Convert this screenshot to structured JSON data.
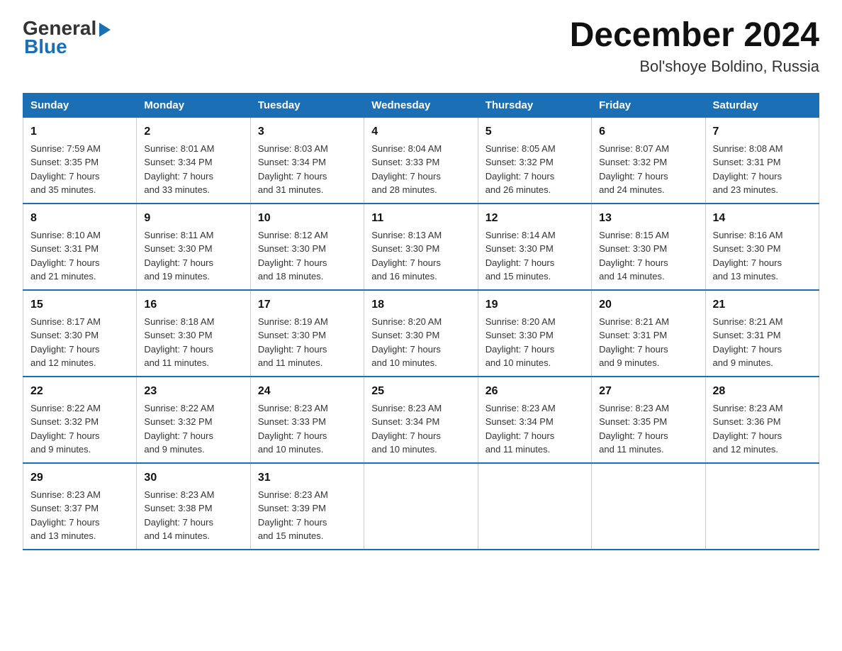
{
  "logo": {
    "text_general": "General",
    "arrow": "▶",
    "text_blue": "Blue"
  },
  "title": "December 2024",
  "subtitle": "Bol'shoye Boldino, Russia",
  "days_of_week": [
    "Sunday",
    "Monday",
    "Tuesday",
    "Wednesday",
    "Thursday",
    "Friday",
    "Saturday"
  ],
  "weeks": [
    [
      {
        "day": "1",
        "sunrise": "7:59 AM",
        "sunset": "3:35 PM",
        "daylight": "7 hours and 35 minutes."
      },
      {
        "day": "2",
        "sunrise": "8:01 AM",
        "sunset": "3:34 PM",
        "daylight": "7 hours and 33 minutes."
      },
      {
        "day": "3",
        "sunrise": "8:03 AM",
        "sunset": "3:34 PM",
        "daylight": "7 hours and 31 minutes."
      },
      {
        "day": "4",
        "sunrise": "8:04 AM",
        "sunset": "3:33 PM",
        "daylight": "7 hours and 28 minutes."
      },
      {
        "day": "5",
        "sunrise": "8:05 AM",
        "sunset": "3:32 PM",
        "daylight": "7 hours and 26 minutes."
      },
      {
        "day": "6",
        "sunrise": "8:07 AM",
        "sunset": "3:32 PM",
        "daylight": "7 hours and 24 minutes."
      },
      {
        "day": "7",
        "sunrise": "8:08 AM",
        "sunset": "3:31 PM",
        "daylight": "7 hours and 23 minutes."
      }
    ],
    [
      {
        "day": "8",
        "sunrise": "8:10 AM",
        "sunset": "3:31 PM",
        "daylight": "7 hours and 21 minutes."
      },
      {
        "day": "9",
        "sunrise": "8:11 AM",
        "sunset": "3:30 PM",
        "daylight": "7 hours and 19 minutes."
      },
      {
        "day": "10",
        "sunrise": "8:12 AM",
        "sunset": "3:30 PM",
        "daylight": "7 hours and 18 minutes."
      },
      {
        "day": "11",
        "sunrise": "8:13 AM",
        "sunset": "3:30 PM",
        "daylight": "7 hours and 16 minutes."
      },
      {
        "day": "12",
        "sunrise": "8:14 AM",
        "sunset": "3:30 PM",
        "daylight": "7 hours and 15 minutes."
      },
      {
        "day": "13",
        "sunrise": "8:15 AM",
        "sunset": "3:30 PM",
        "daylight": "7 hours and 14 minutes."
      },
      {
        "day": "14",
        "sunrise": "8:16 AM",
        "sunset": "3:30 PM",
        "daylight": "7 hours and 13 minutes."
      }
    ],
    [
      {
        "day": "15",
        "sunrise": "8:17 AM",
        "sunset": "3:30 PM",
        "daylight": "7 hours and 12 minutes."
      },
      {
        "day": "16",
        "sunrise": "8:18 AM",
        "sunset": "3:30 PM",
        "daylight": "7 hours and 11 minutes."
      },
      {
        "day": "17",
        "sunrise": "8:19 AM",
        "sunset": "3:30 PM",
        "daylight": "7 hours and 11 minutes."
      },
      {
        "day": "18",
        "sunrise": "8:20 AM",
        "sunset": "3:30 PM",
        "daylight": "7 hours and 10 minutes."
      },
      {
        "day": "19",
        "sunrise": "8:20 AM",
        "sunset": "3:30 PM",
        "daylight": "7 hours and 10 minutes."
      },
      {
        "day": "20",
        "sunrise": "8:21 AM",
        "sunset": "3:31 PM",
        "daylight": "7 hours and 9 minutes."
      },
      {
        "day": "21",
        "sunrise": "8:21 AM",
        "sunset": "3:31 PM",
        "daylight": "7 hours and 9 minutes."
      }
    ],
    [
      {
        "day": "22",
        "sunrise": "8:22 AM",
        "sunset": "3:32 PM",
        "daylight": "7 hours and 9 minutes."
      },
      {
        "day": "23",
        "sunrise": "8:22 AM",
        "sunset": "3:32 PM",
        "daylight": "7 hours and 9 minutes."
      },
      {
        "day": "24",
        "sunrise": "8:23 AM",
        "sunset": "3:33 PM",
        "daylight": "7 hours and 10 minutes."
      },
      {
        "day": "25",
        "sunrise": "8:23 AM",
        "sunset": "3:34 PM",
        "daylight": "7 hours and 10 minutes."
      },
      {
        "day": "26",
        "sunrise": "8:23 AM",
        "sunset": "3:34 PM",
        "daylight": "7 hours and 11 minutes."
      },
      {
        "day": "27",
        "sunrise": "8:23 AM",
        "sunset": "3:35 PM",
        "daylight": "7 hours and 11 minutes."
      },
      {
        "day": "28",
        "sunrise": "8:23 AM",
        "sunset": "3:36 PM",
        "daylight": "7 hours and 12 minutes."
      }
    ],
    [
      {
        "day": "29",
        "sunrise": "8:23 AM",
        "sunset": "3:37 PM",
        "daylight": "7 hours and 13 minutes."
      },
      {
        "day": "30",
        "sunrise": "8:23 AM",
        "sunset": "3:38 PM",
        "daylight": "7 hours and 14 minutes."
      },
      {
        "day": "31",
        "sunrise": "8:23 AM",
        "sunset": "3:39 PM",
        "daylight": "7 hours and 15 minutes."
      },
      null,
      null,
      null,
      null
    ]
  ]
}
